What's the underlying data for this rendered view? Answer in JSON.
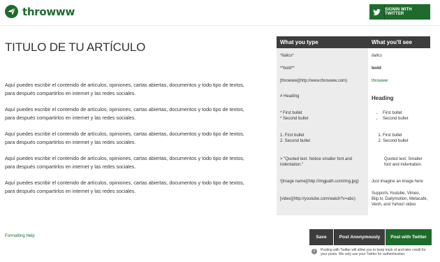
{
  "header": {
    "logo_text": "throwww",
    "signin_label": "SIGNIN WITH TWITTER"
  },
  "article": {
    "title": "TITULO DE TU ARTÍCULO",
    "paragraphs": [
      "Aquí puedes escribir el contenido de artículos, opiniones, cartas abiertas, documentos y todo tipo de textos, para después compartirlos en internet y las redes sociales.",
      "Aquí puedes escribir el contenido de artículos, opiniones, cartas abiertas, documentos y todo tipo de textos, para después compartirlos en internet y las redes sociales.",
      "Aquí puedes escribir el contenido de artículos, opiniones, cartas abiertas, documentos y todo tipo de textos, para después compartirlos en internet y las redes sociales.",
      "Aquí puedes escribir el contenido de artículos, opiniones, cartas abiertas, documentos y todo tipo de textos, para después compartirlos en internet y las redes sociales.",
      "Aquí puedes escribir el contenido de artículos, opiniones, cartas abiertas, documentos y todo tipo de textos, para después compartirlos en internet y las redes sociales."
    ]
  },
  "formatting": {
    "col_type": "What you type",
    "col_see": "What you'll see",
    "italics_in": "*italics*",
    "italics_out": "italics",
    "bold_in": "**bold**",
    "bold_out": "bold",
    "link_in": "[throwww](http://www.throwww.com)",
    "link_out": "throwww",
    "heading_in": "# Heading",
    "heading_out": "Heading",
    "bullet_in_1": "* First bullet",
    "bullet_in_2": "* Second bullet",
    "bullet_out_1": "First bullet",
    "bullet_out_2": "Second bullet",
    "num_in_1": "1. First bullet",
    "num_in_2": "2. Second bullet",
    "num_out_1": "First bullet",
    "num_out_2": "Second bullet",
    "quote_in": "> \"Quoted text. Notice smaller font and indentation.\"",
    "quote_out": "Quoted text. Smaller font and indentation.",
    "image_in": "![Image name](http://imgpath.com/img.jpg)",
    "image_out": "Just imagine an image here",
    "video_in": "[video](http://youtube.com/watch?v=abc)",
    "video_out": "Supports Youtube, Vimeo, Blip.tv, Dailymotion, Metacafe, Veoh, and Yahoo! video"
  },
  "footer": {
    "help_link": "Formatting Help",
    "save_label": "Save",
    "anon_label": "Post Anonymously",
    "twitter_label": "Post with Twitter",
    "note": "Posting with Twitter will allow you to keep track of and take credit for your posts. We only use your Twitter for authentication."
  },
  "colors": {
    "brand_green": "#1e6b2c",
    "dark_gray": "#3d3d3d"
  }
}
